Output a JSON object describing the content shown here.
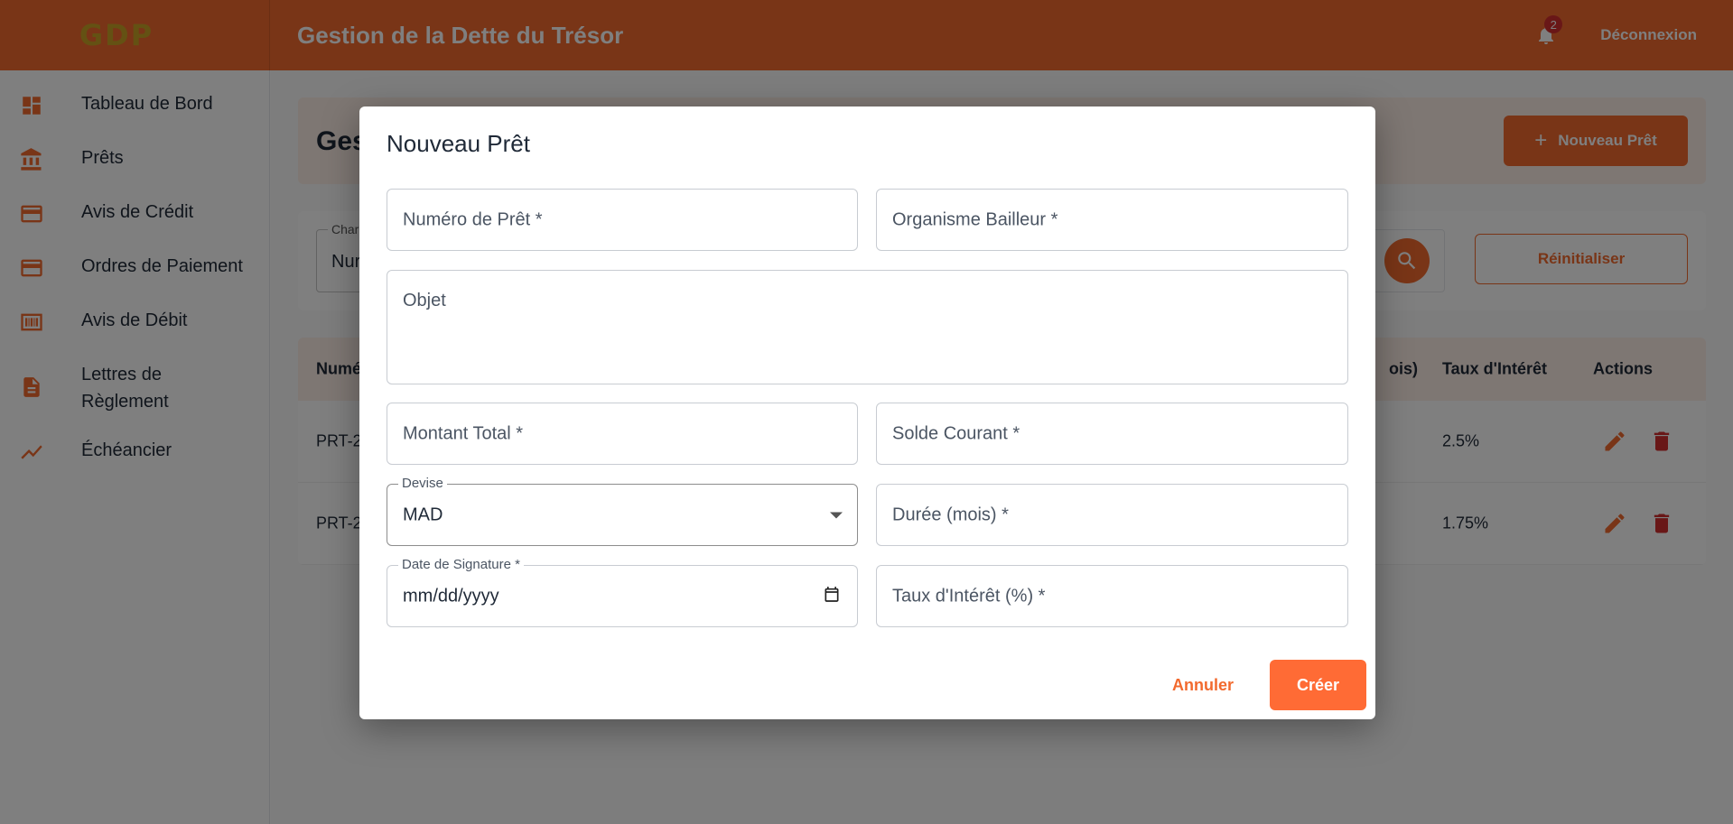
{
  "appbar": {
    "brand": "GDP",
    "title": "Gestion de la Dette du Trésor",
    "notification_count": "2",
    "logout_label": "Déconnexion"
  },
  "sidebar": {
    "items": [
      {
        "label": "Tableau de Bord",
        "icon": "dashboard-icon"
      },
      {
        "label": "Prêts",
        "icon": "bank-icon"
      },
      {
        "label": "Avis de Crédit",
        "icon": "credit-card-icon"
      },
      {
        "label": "Ordres de Paiement",
        "icon": "payment-card-icon"
      },
      {
        "label": "Avis de Débit",
        "icon": "debit-icon"
      },
      {
        "label": "Lettres de Règlement",
        "icon": "document-icon"
      },
      {
        "label": "Échéancier",
        "icon": "trend-icon"
      }
    ]
  },
  "main": {
    "header_title_visible": "Ges",
    "new_button_label": "Nouveau Prêt",
    "filter": {
      "label_visible": "Char",
      "value_visible": "Nur"
    },
    "reset_label": "Réinitialiser",
    "table": {
      "headers": {
        "first_visible": "Numé",
        "duration_visible": "ois)",
        "rate": "Taux d'Intérêt",
        "actions": "Actions"
      },
      "rows": [
        {
          "first_visible": "PRT-2",
          "rate": "2.5%"
        },
        {
          "first_visible": "PRT-2",
          "rate": "1.75%"
        }
      ]
    }
  },
  "dialog": {
    "title": "Nouveau Prêt",
    "fields": {
      "loan_number": "Numéro de Prêt *",
      "lender": "Organisme Bailleur *",
      "object": "Objet",
      "total_amount": "Montant Total *",
      "current_balance": "Solde Courant *",
      "currency_label": "Devise",
      "currency_value": "MAD",
      "duration": "Durée (mois) *",
      "signature_label": "Date de Signature *",
      "signature_placeholder": "mm/dd/yyyy",
      "interest_rate": "Taux d'Intérêt (%) *"
    },
    "cancel_label": "Annuler",
    "create_label": "Créer"
  },
  "colors": {
    "primary": "#f26a2e",
    "accent_button": "#ff6b35",
    "danger": "#d32f2f",
    "brand_gold": "#c9a227"
  }
}
